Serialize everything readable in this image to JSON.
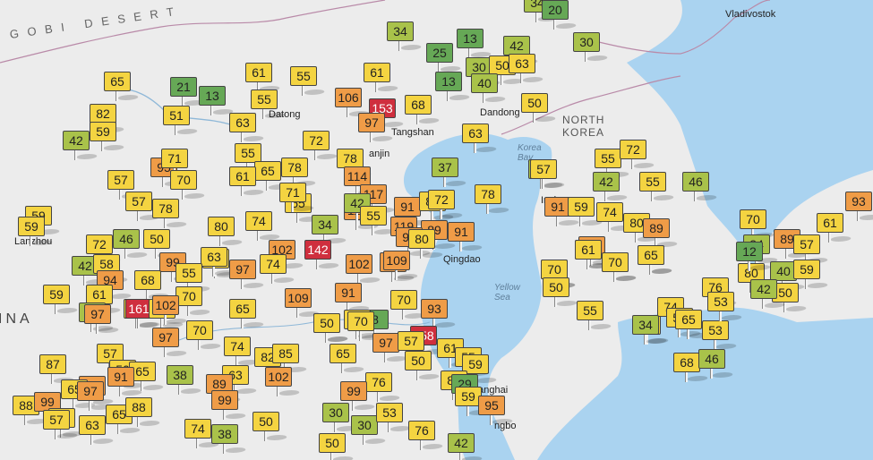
{
  "colors": {
    "good": "#66a856",
    "good_moderate": "#a9c24a",
    "moderate": "#f4d441",
    "sensitive": "#ef9c47",
    "unhealthy": "#cf2f3e",
    "land": "#ececec",
    "sea": "#aad3f0"
  },
  "places": [
    {
      "id": "gobi-desert",
      "label": "G O B I   D E S E R T",
      "kind": "desert"
    },
    {
      "id": "vladivostok",
      "label": "Vladivostok",
      "kind": "city"
    },
    {
      "id": "north-korea",
      "label": "NORTH\nKOREA",
      "kind": "country"
    },
    {
      "id": "korea-bay",
      "label": "Korea\nBay",
      "kind": "water"
    },
    {
      "id": "yellow-sea",
      "label": "Yellow\nSea",
      "kind": "water"
    },
    {
      "id": "china",
      "label": "INA",
      "kind": "country-large"
    },
    {
      "id": "datong",
      "label": "Datong",
      "kind": "city"
    },
    {
      "id": "tangshan",
      "label": "Tangshan",
      "kind": "city"
    },
    {
      "id": "dandong",
      "label": "Dandong",
      "kind": "city"
    },
    {
      "id": "qingdao",
      "label": "Qingdao",
      "kind": "city"
    },
    {
      "id": "lanzhou",
      "label": "Lanzhou",
      "kind": "city"
    },
    {
      "id": "shanghai",
      "label": "hanghai",
      "kind": "city"
    },
    {
      "id": "tianjin",
      "label": "anjin",
      "kind": "city"
    },
    {
      "id": "ningbo",
      "label": "ngbo",
      "kind": "city"
    },
    {
      "id": "incheon",
      "label": "Inch",
      "kind": "city"
    }
  ],
  "stations": [
    {
      "v": 34,
      "c": "good_moderate"
    },
    {
      "v": 20,
      "c": "good"
    },
    {
      "v": 13,
      "c": "good"
    },
    {
      "v": 42,
      "c": "good_moderate"
    },
    {
      "v": 34,
      "c": "good_moderate"
    },
    {
      "v": 30,
      "c": "good_moderate"
    },
    {
      "v": 25,
      "c": "good"
    },
    {
      "v": 30,
      "c": "good_moderate"
    },
    {
      "v": 50,
      "c": "moderate"
    },
    {
      "v": 63,
      "c": "moderate"
    },
    {
      "v": 13,
      "c": "good"
    },
    {
      "v": 40,
      "c": "good_moderate"
    },
    {
      "v": 65,
      "c": "moderate"
    },
    {
      "v": 21,
      "c": "good"
    },
    {
      "v": 13,
      "c": "good"
    },
    {
      "v": 61,
      "c": "moderate"
    },
    {
      "v": 55,
      "c": "moderate"
    },
    {
      "v": 61,
      "c": "moderate"
    },
    {
      "v": 106,
      "c": "sensitive"
    },
    {
      "v": 153,
      "c": "unhealthy"
    },
    {
      "v": 68,
      "c": "moderate"
    },
    {
      "v": 50,
      "c": "moderate"
    },
    {
      "v": 82,
      "c": "moderate"
    },
    {
      "v": 51,
      "c": "moderate"
    },
    {
      "v": 63,
      "c": "moderate"
    },
    {
      "v": 55,
      "c": "moderate"
    },
    {
      "v": 97,
      "c": "sensitive"
    },
    {
      "v": 63,
      "c": "moderate"
    },
    {
      "v": 42,
      "c": "good_moderate"
    },
    {
      "v": 59,
      "c": "moderate"
    },
    {
      "v": 72,
      "c": "moderate"
    },
    {
      "v": 78,
      "c": "moderate"
    },
    {
      "v": 42,
      "c": "good_moderate"
    },
    {
      "v": 55,
      "c": "moderate"
    },
    {
      "v": 95,
      "c": "sensitive"
    },
    {
      "v": 71,
      "c": "moderate"
    },
    {
      "v": 65,
      "c": "moderate"
    },
    {
      "v": 78,
      "c": "moderate"
    },
    {
      "v": 114,
      "c": "sensitive"
    },
    {
      "v": 37,
      "c": "good_moderate"
    },
    {
      "v": 57,
      "c": "moderate"
    },
    {
      "v": 70,
      "c": "moderate"
    },
    {
      "v": 61,
      "c": "moderate"
    },
    {
      "v": 117,
      "c": "sensitive"
    },
    {
      "v": 78,
      "c": "moderate"
    },
    {
      "v": 57,
      "c": "moderate"
    },
    {
      "v": 55,
      "c": "moderate"
    },
    {
      "v": 59,
      "c": "moderate"
    },
    {
      "v": 78,
      "c": "moderate"
    },
    {
      "v": 71,
      "c": "moderate"
    },
    {
      "v": 117,
      "c": "sensitive"
    },
    {
      "v": 91,
      "c": "sensitive"
    },
    {
      "v": 85,
      "c": "moderate"
    },
    {
      "v": 72,
      "c": "moderate"
    },
    {
      "v": 42,
      "c": "good_moderate"
    },
    {
      "v": 55,
      "c": "moderate"
    },
    {
      "v": 59,
      "c": "moderate"
    },
    {
      "v": 80,
      "c": "moderate"
    },
    {
      "v": 74,
      "c": "moderate"
    },
    {
      "v": 34,
      "c": "good_moderate"
    },
    {
      "v": 119,
      "c": "sensitive"
    },
    {
      "v": 89,
      "c": "sensitive"
    },
    {
      "v": 91,
      "c": "sensitive"
    },
    {
      "v": 46,
      "c": "good_moderate"
    },
    {
      "v": 50,
      "c": "moderate"
    },
    {
      "v": 72,
      "c": "moderate"
    },
    {
      "v": 102,
      "c": "sensitive"
    },
    {
      "v": 142,
      "c": "unhealthy"
    },
    {
      "v": 99,
      "c": "sensitive"
    },
    {
      "v": 74,
      "c": "moderate"
    },
    {
      "v": 59,
      "c": "moderate"
    },
    {
      "v": 42,
      "c": "good_moderate"
    },
    {
      "v": 58,
      "c": "moderate"
    },
    {
      "v": 99,
      "c": "sensitive"
    },
    {
      "v": 63,
      "c": "moderate"
    },
    {
      "v": 97,
      "c": "sensitive"
    },
    {
      "v": 99,
      "c": "sensitive"
    },
    {
      "v": 102,
      "c": "sensitive"
    },
    {
      "v": 109,
      "c": "sensitive"
    },
    {
      "v": 80,
      "c": "moderate"
    },
    {
      "v": 89,
      "c": "sensitive"
    },
    {
      "v": 89,
      "c": "sensitive"
    },
    {
      "v": 61,
      "c": "moderate"
    },
    {
      "v": 75,
      "c": "moderate"
    },
    {
      "v": 94,
      "c": "sensitive"
    },
    {
      "v": 68,
      "c": "moderate"
    },
    {
      "v": 55,
      "c": "moderate"
    },
    {
      "v": 65,
      "c": "moderate"
    },
    {
      "v": 109,
      "c": "sensitive"
    },
    {
      "v": 91,
      "c": "sensitive"
    },
    {
      "v": 70,
      "c": "moderate"
    },
    {
      "v": 65,
      "c": "moderate"
    },
    {
      "v": 59,
      "c": "moderate"
    },
    {
      "v": 57,
      "c": "moderate"
    },
    {
      "v": 61,
      "c": "moderate"
    },
    {
      "v": 93,
      "c": "sensitive"
    },
    {
      "v": 37,
      "c": "good_moderate"
    },
    {
      "v": 97,
      "c": "sensitive"
    },
    {
      "v": 161,
      "c": "unhealthy"
    },
    {
      "v": 74,
      "c": "moderate"
    },
    {
      "v": 8,
      "c": "good"
    },
    {
      "v": 70,
      "c": "moderate"
    },
    {
      "v": 102,
      "c": "sensitive"
    },
    {
      "v": 97,
      "c": "sensitive"
    },
    {
      "v": 70,
      "c": "moderate"
    },
    {
      "v": 50,
      "c": "moderate"
    },
    {
      "v": 87,
      "c": "moderate"
    },
    {
      "v": 158,
      "c": "unhealthy"
    },
    {
      "v": 70,
      "c": "moderate"
    },
    {
      "v": 97,
      "c": "sensitive"
    },
    {
      "v": 74,
      "c": "moderate"
    },
    {
      "v": 57,
      "c": "moderate"
    },
    {
      "v": 61,
      "c": "moderate"
    },
    {
      "v": 65,
      "c": "moderate"
    },
    {
      "v": 82,
      "c": "moderate"
    },
    {
      "v": 85,
      "c": "moderate"
    },
    {
      "v": 55,
      "c": "moderate"
    },
    {
      "v": 57,
      "c": "moderate"
    },
    {
      "v": 87,
      "c": "moderate"
    },
    {
      "v": 50,
      "c": "moderate"
    },
    {
      "v": 65,
      "c": "moderate"
    },
    {
      "v": 38,
      "c": "good_moderate"
    },
    {
      "v": 63,
      "c": "moderate"
    },
    {
      "v": 59,
      "c": "moderate"
    },
    {
      "v": 91,
      "c": "sensitive"
    },
    {
      "v": 92,
      "c": "sensitive"
    },
    {
      "v": 65,
      "c": "moderate"
    },
    {
      "v": 89,
      "c": "sensitive"
    },
    {
      "v": 102,
      "c": "sensitive"
    },
    {
      "v": 76,
      "c": "moderate"
    },
    {
      "v": 80,
      "c": "moderate"
    },
    {
      "v": 29,
      "c": "good"
    },
    {
      "v": 50,
      "c": "moderate"
    },
    {
      "v": 97,
      "c": "sensitive"
    },
    {
      "v": 99,
      "c": "sensitive"
    },
    {
      "v": 88,
      "c": "moderate"
    },
    {
      "v": 99,
      "c": "sensitive"
    },
    {
      "v": 59,
      "c": "moderate"
    },
    {
      "v": 57,
      "c": "moderate"
    },
    {
      "v": 63,
      "c": "moderate"
    },
    {
      "v": 65,
      "c": "moderate"
    },
    {
      "v": 95,
      "c": "sensitive"
    },
    {
      "v": 99,
      "c": "sensitive"
    },
    {
      "v": 88,
      "c": "moderate"
    },
    {
      "v": 57,
      "c": "moderate"
    },
    {
      "v": 50,
      "c": "moderate"
    },
    {
      "v": 30,
      "c": "good_moderate"
    },
    {
      "v": 30,
      "c": "good_moderate"
    },
    {
      "v": 53,
      "c": "moderate"
    },
    {
      "v": 74,
      "c": "moderate"
    },
    {
      "v": 38,
      "c": "good_moderate"
    },
    {
      "v": 50,
      "c": "moderate"
    },
    {
      "v": 93,
      "c": "sensitive"
    },
    {
      "v": 76,
      "c": "moderate"
    },
    {
      "v": 42,
      "c": "good_moderate"
    },
    {
      "v": 57,
      "c": "moderate"
    },
    {
      "v": 55,
      "c": "moderate"
    },
    {
      "v": 72,
      "c": "moderate"
    },
    {
      "v": 42,
      "c": "good_moderate"
    },
    {
      "v": 55,
      "c": "moderate"
    },
    {
      "v": 46,
      "c": "good_moderate"
    },
    {
      "v": 91,
      "c": "sensitive"
    },
    {
      "v": 59,
      "c": "moderate"
    },
    {
      "v": 74,
      "c": "moderate"
    },
    {
      "v": 80,
      "c": "moderate"
    },
    {
      "v": 89,
      "c": "sensitive"
    },
    {
      "v": 89,
      "c": "sensitive"
    },
    {
      "v": 61,
      "c": "moderate"
    },
    {
      "v": 70,
      "c": "moderate"
    },
    {
      "v": 65,
      "c": "moderate"
    },
    {
      "v": 70,
      "c": "moderate"
    },
    {
      "v": 50,
      "c": "moderate"
    },
    {
      "v": 55,
      "c": "moderate"
    },
    {
      "v": 57,
      "c": "moderate"
    },
    {
      "v": 74,
      "c": "moderate"
    },
    {
      "v": 57,
      "c": "moderate"
    },
    {
      "v": 65,
      "c": "moderate"
    },
    {
      "v": 53,
      "c": "moderate"
    },
    {
      "v": 68,
      "c": "moderate"
    },
    {
      "v": 46,
      "c": "good_moderate"
    },
    {
      "v": 76,
      "c": "moderate"
    },
    {
      "v": 53,
      "c": "moderate"
    },
    {
      "v": 70,
      "c": "moderate"
    },
    {
      "v": 34,
      "c": "good_moderate"
    },
    {
      "v": 89,
      "c": "sensitive"
    },
    {
      "v": 57,
      "c": "moderate"
    },
    {
      "v": 61,
      "c": "moderate"
    },
    {
      "v": 93,
      "c": "sensitive"
    },
    {
      "v": 50,
      "c": "moderate"
    },
    {
      "v": 40,
      "c": "good_moderate"
    },
    {
      "v": 59,
      "c": "moderate"
    },
    {
      "v": 80,
      "c": "moderate"
    },
    {
      "v": 50,
      "c": "moderate"
    },
    {
      "v": 34,
      "c": "good_moderate"
    },
    {
      "v": 12,
      "c": "good"
    },
    {
      "v": 42,
      "c": "good_moderate"
    }
  ]
}
